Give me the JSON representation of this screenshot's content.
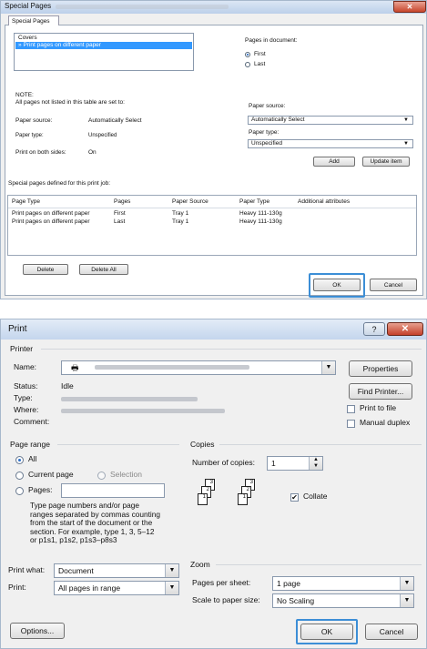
{
  "special_pages": {
    "title": "Special Pages",
    "close_glyph": "✕",
    "tab_label": "Special Pages",
    "list_items": [
      "Covers",
      "Print pages on different paper"
    ],
    "selected_marker": "»",
    "pages_in_document_label": "Pages in document:",
    "radio_first": "First",
    "radio_last": "Last",
    "note_title": "NOTE:",
    "note_text": "All pages not listed in this table are set to:",
    "paper_source_label": "Paper source:",
    "paper_source_value": "Automatically Select",
    "paper_type_label": "Paper type:",
    "paper_type_value": "Unspecified",
    "print_both_sides_label": "Print on both sides:",
    "print_both_sides_value": "On",
    "right_paper_source_label": "Paper source:",
    "right_paper_source_value": "Automatically Select",
    "right_paper_type_label": "Paper type:",
    "right_paper_type_value": "Unspecified",
    "add_button": "Add",
    "update_button": "Update item",
    "defined_label": "Special pages defined for this print job:",
    "table_headers": [
      "Page Type",
      "Pages",
      "Paper Source",
      "Paper Type",
      "Additional attributes"
    ],
    "table_rows": [
      [
        "Print pages on different paper",
        "First",
        "Tray 1",
        "Heavy 111-130g",
        ""
      ],
      [
        "Print pages on different paper",
        "Last",
        "Tray 1",
        "Heavy 111-130g",
        ""
      ]
    ],
    "delete_button": "Delete",
    "delete_all_button": "Delete All",
    "ok_button": "OK",
    "cancel_button": "Cancel"
  },
  "print": {
    "title": "Print",
    "help_glyph": "?",
    "close_glyph": "✕",
    "printer_group": "Printer",
    "name_label": "Name:",
    "properties_button": "Properties",
    "status_label": "Status:",
    "status_value": "Idle",
    "type_label": "Type:",
    "where_label": "Where:",
    "comment_label": "Comment:",
    "find_printer_button": "Find Printer...",
    "print_to_file": "Print to file",
    "manual_duplex": "Manual duplex",
    "page_range_group": "Page range",
    "all": "All",
    "current_page": "Current page",
    "selection": "Selection",
    "pages": "Pages:",
    "pages_help": [
      "Type page numbers and/or page",
      "ranges separated by commas counting",
      "from the start of the document or the",
      "section. For example, type 1, 3, 5–12",
      "or p1s1, p1s2, p1s3–p8s3"
    ],
    "copies_group": "Copies",
    "number_of_copies_label": "Number of copies:",
    "number_of_copies_value": "1",
    "collate": "Collate",
    "print_what_label": "Print what:",
    "print_what_value": "Document",
    "print_label": "Print:",
    "print_value": "All pages in range",
    "zoom_group": "Zoom",
    "pages_per_sheet_label": "Pages per sheet:",
    "pages_per_sheet_value": "1 page",
    "scale_label": "Scale to paper size:",
    "scale_value": "No Scaling",
    "options_button": "Options...",
    "ok_button": "OK",
    "cancel_button": "Cancel",
    "collate_pages": [
      "1",
      "2",
      "3",
      "1",
      "2",
      "3"
    ]
  },
  "colors": {
    "accent": "#3c8ed6",
    "selection": "#3399ff"
  }
}
